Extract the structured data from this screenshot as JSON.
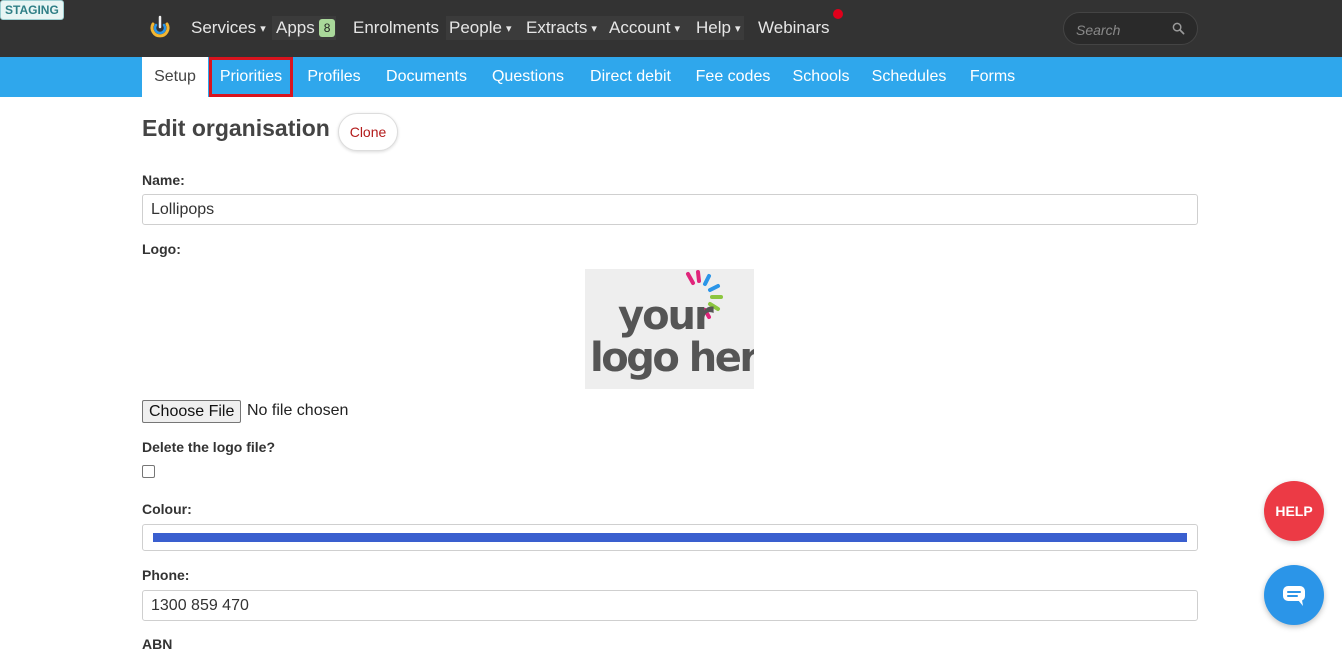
{
  "env_badge": "STAGING",
  "topnav": {
    "items": [
      {
        "label": "Services",
        "caret": true
      },
      {
        "label": "Apps",
        "badge": "8"
      },
      {
        "label": "Enrolments"
      },
      {
        "label": "People",
        "caret": true
      },
      {
        "label": "Extracts",
        "caret": true
      },
      {
        "label": "Account",
        "caret": true
      },
      {
        "label": "Help",
        "caret": true
      },
      {
        "label": "Webinars"
      }
    ],
    "caret_glyph": "▾",
    "search_placeholder": "Search"
  },
  "subnav": {
    "tabs": [
      "Setup",
      "Priorities",
      "Profiles",
      "Documents",
      "Questions",
      "Direct debit",
      "Fee codes",
      "Schools",
      "Schedules",
      "Forms"
    ],
    "active_tab": "Setup",
    "highlighted_tab": "Priorities"
  },
  "page": {
    "title": "Edit organisation",
    "clone_label": "Clone"
  },
  "form": {
    "name_label": "Name:",
    "name_value": "Lollipops",
    "logo_label": "Logo:",
    "logo_image": {
      "line1": "your",
      "line2": "logo here"
    },
    "choose_file_label": "Choose File",
    "no_file_text": "No file chosen",
    "delete_logo_label": "Delete the logo file?",
    "delete_logo_checked": false,
    "colour_label": "Colour:",
    "colour_value": "#3a5fcf",
    "phone_label": "Phone:",
    "phone_value": "1300 859 470",
    "abn_label": "ABN"
  },
  "widgets": {
    "help_label": "HELP",
    "chat_icon": "chat-icon"
  },
  "colors": {
    "topbar": "#333333",
    "subnav": "#2fa7ec",
    "highlight_border": "#d8141e",
    "help_bubble": "#ec3a45",
    "chat_bubble": "#2b95e8",
    "notification_dot": "#e0001b"
  }
}
